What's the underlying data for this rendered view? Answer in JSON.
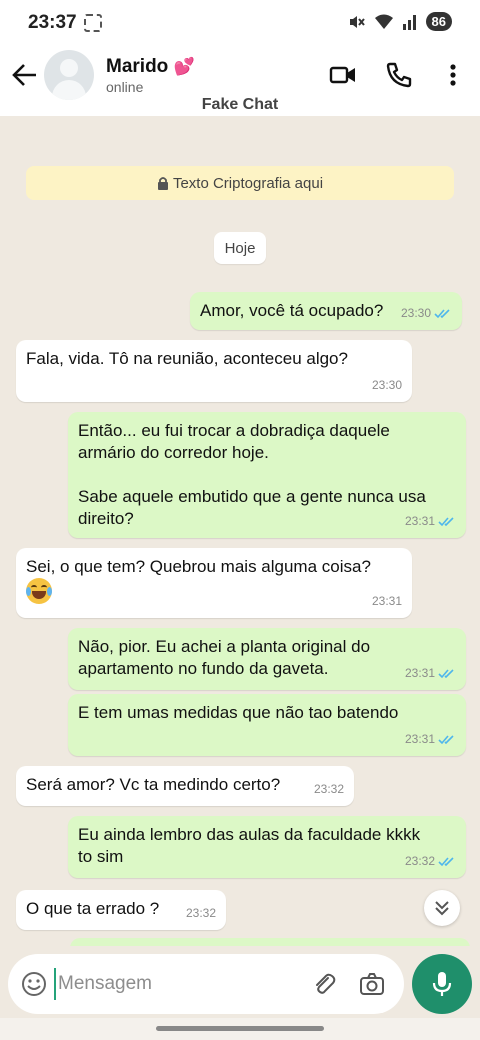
{
  "statusbar": {
    "time": "23:37",
    "battery": "86"
  },
  "header": {
    "contact_name": "Marido",
    "contact_emoji": "💕",
    "contact_status": "online",
    "title": "Fake Chat"
  },
  "chat": {
    "encryption_notice": "Texto Criptografia aqui",
    "date_chip": "Hoje",
    "messages": [
      {
        "direction": "out",
        "text": "Amor, você tá ocupado?",
        "time": "23:30",
        "read": true
      },
      {
        "direction": "in",
        "text": "Fala, vida. Tô na reunião, aconteceu algo?",
        "time": "23:30"
      },
      {
        "direction": "out",
        "text": "Então... eu fui trocar a dobradiça daquele\narmário do corredor hoje.\n\nSabe aquele embutido que a gente nunca usa\ndireito?",
        "time": "23:31",
        "read": true
      },
      {
        "direction": "in",
        "text": "Sei, o que tem? Quebrou mais alguma coisa?",
        "emoji": "face-with-tears-of-joy",
        "time": "23:31"
      },
      {
        "direction": "out",
        "text": "Não, pior. Eu achei a planta original do\napartamento no fundo da gaveta.",
        "time": "23:31",
        "read": true
      },
      {
        "direction": "out",
        "text": "E tem umas medidas que não tao batendo",
        "time": "23:31",
        "read": true
      },
      {
        "direction": "in",
        "text": "Será amor? Vc ta medindo certo?",
        "time": "23:32"
      },
      {
        "direction": "out",
        "text": "Eu ainda lembro das aulas da faculdade kkkk\nto sim",
        "time": "23:32",
        "read": true
      },
      {
        "direction": "in",
        "text": "O que ta errado ?",
        "time": "23:32"
      }
    ]
  },
  "input": {
    "placeholder": "Mensagem"
  },
  "colors": {
    "out_bubble": "#dcf8c6",
    "in_bubble": "#ffffff",
    "accent": "#1f8f6b",
    "read_ticks": "#4fb6ec",
    "chat_bg": "#efe9e0"
  }
}
